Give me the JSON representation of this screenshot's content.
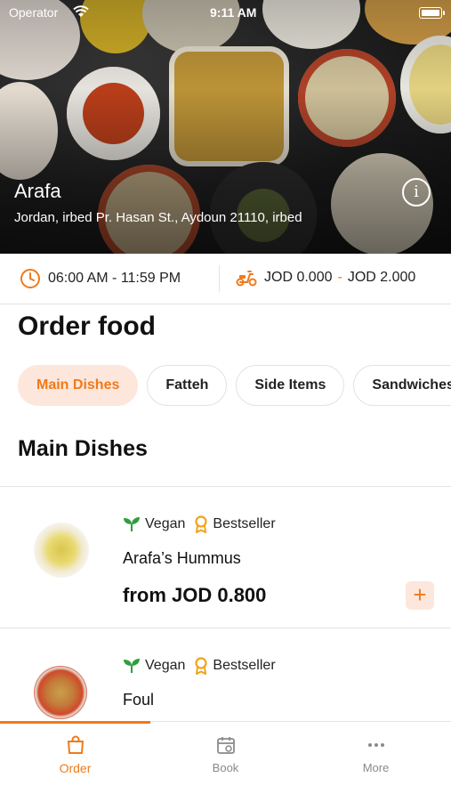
{
  "status_bar": {
    "carrier": "Operator",
    "time": "9:11 AM"
  },
  "restaurant": {
    "name": "Arafa",
    "address": "Jordan, irbed Pr. Hasan St., Aydoun 21110, irbed"
  },
  "meta": {
    "hours": "06:00 AM - 11:59 PM",
    "delivery_fee_min": "JOD 0.000",
    "delivery_fee_max": "JOD 2.000",
    "fee_separator": "-"
  },
  "page": {
    "title": "Order food"
  },
  "categories": [
    {
      "label": "Main Dishes",
      "selected": true
    },
    {
      "label": "Fatteh",
      "selected": false
    },
    {
      "label": "Side Items",
      "selected": false
    },
    {
      "label": "Sandwiches",
      "selected": false
    }
  ],
  "current_category": "Main Dishes",
  "menu_items": [
    {
      "tags": [
        "Vegan",
        "Bestseller"
      ],
      "name": "Arafa’s Hummus",
      "price": "from JOD 0.800",
      "add_label": "+"
    },
    {
      "tags": [
        "Vegan",
        "Bestseller"
      ],
      "name": "Foul"
    }
  ],
  "tabs": [
    {
      "label": "Order",
      "icon": "bag-icon",
      "active": true
    },
    {
      "label": "Book",
      "icon": "calendar-icon",
      "active": false
    },
    {
      "label": "More",
      "icon": "more-icon",
      "active": false
    }
  ],
  "colors": {
    "accent": "#f07a1a",
    "accent_light": "#fde7dd",
    "tag_green": "#2e9e3e",
    "tag_gold": "#f0a41a"
  }
}
